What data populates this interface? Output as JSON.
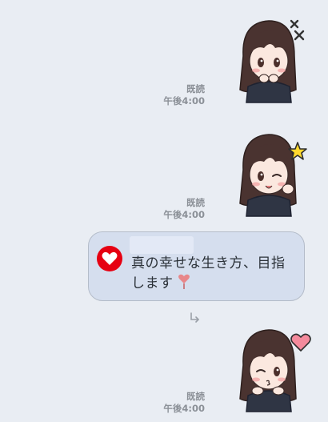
{
  "messages": [
    {
      "read_label": "既読",
      "time": "午後4:00"
    },
    {
      "read_label": "既読",
      "time": "午後4:00"
    },
    {
      "read_label": "既読",
      "time": "午後4:00"
    }
  ],
  "reply": {
    "message_line1": "真の幸せな生き方、目指",
    "message_line2": "します"
  },
  "colors": {
    "background": "#e9edf3",
    "bubble": "#d5deee",
    "badge": "#e60012",
    "meta_text": "#8b9097"
  },
  "icons": [
    "heart-icon",
    "share-arrow-icon",
    "heart-emoji-icon"
  ]
}
